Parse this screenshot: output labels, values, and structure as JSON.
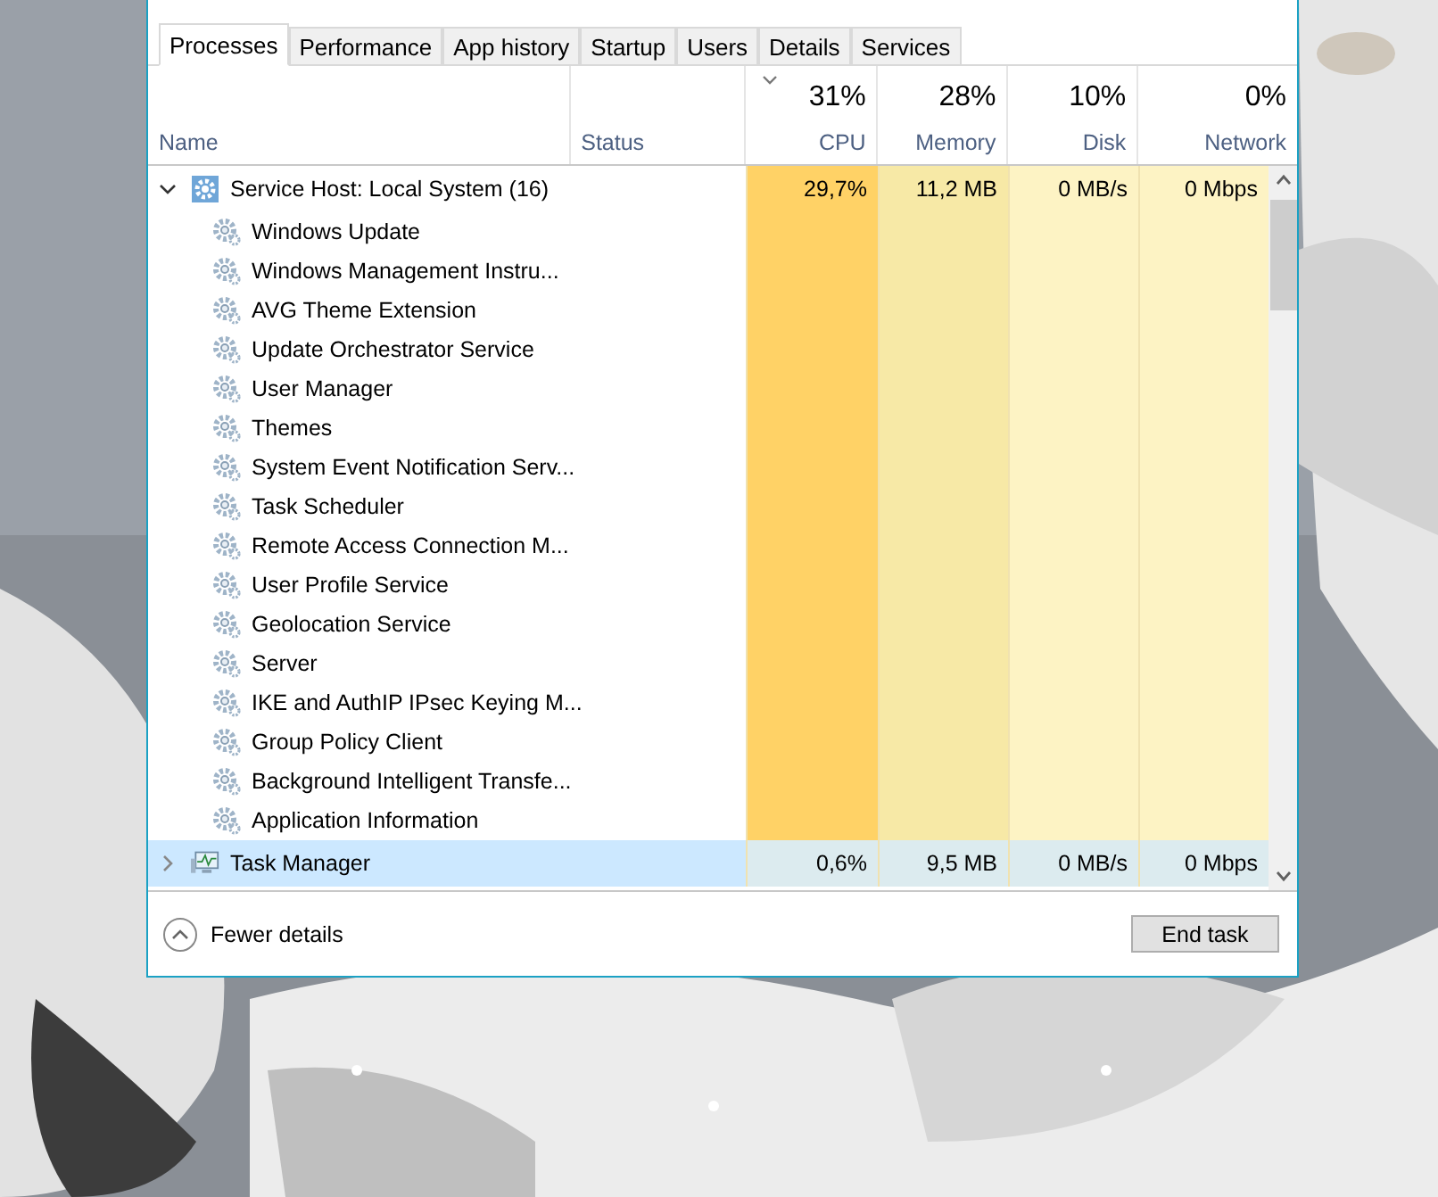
{
  "tabs": [
    {
      "label": "Processes",
      "selected": true
    },
    {
      "label": "Performance",
      "selected": false
    },
    {
      "label": "App history",
      "selected": false
    },
    {
      "label": "Startup",
      "selected": false
    },
    {
      "label": "Users",
      "selected": false
    },
    {
      "label": "Details",
      "selected": false
    },
    {
      "label": "Services",
      "selected": false
    }
  ],
  "columns": [
    {
      "label": "Name"
    },
    {
      "label": "Status"
    },
    {
      "label": "CPU",
      "percent": "31%",
      "sorted": true
    },
    {
      "label": "Memory",
      "percent": "28%",
      "sorted": false
    },
    {
      "label": "Disk",
      "percent": "10%",
      "sorted": false
    },
    {
      "label": "Network",
      "percent": "0%",
      "sorted": false
    }
  ],
  "rows": [
    {
      "name": "Service Host: Local System (16)",
      "kind": "service",
      "expanded": true,
      "selected": false,
      "values": [
        "29,7%",
        "11,2 MB",
        "0 MB/s",
        "0 Mbps"
      ],
      "children": [
        {
          "name": "Windows Update"
        },
        {
          "name": "Windows Management Instru..."
        },
        {
          "name": "AVG Theme Extension"
        },
        {
          "name": "Update Orchestrator Service"
        },
        {
          "name": "User Manager"
        },
        {
          "name": "Themes"
        },
        {
          "name": "System Event Notification Serv..."
        },
        {
          "name": "Task Scheduler"
        },
        {
          "name": "Remote Access Connection M..."
        },
        {
          "name": "User Profile Service"
        },
        {
          "name": "Geolocation Service"
        },
        {
          "name": "Server"
        },
        {
          "name": "IKE and AuthIP IPsec Keying M..."
        },
        {
          "name": "Group Policy Client"
        },
        {
          "name": "Background Intelligent Transfe..."
        },
        {
          "name": "Application Information"
        }
      ]
    },
    {
      "name": "Task Manager",
      "kind": "app",
      "expanded": false,
      "selected": true,
      "values": [
        "0,6%",
        "9,5 MB",
        "0 MB/s",
        "0 Mbps"
      ]
    }
  ],
  "footer": {
    "toggle": "Fewer details",
    "button": "End task"
  }
}
